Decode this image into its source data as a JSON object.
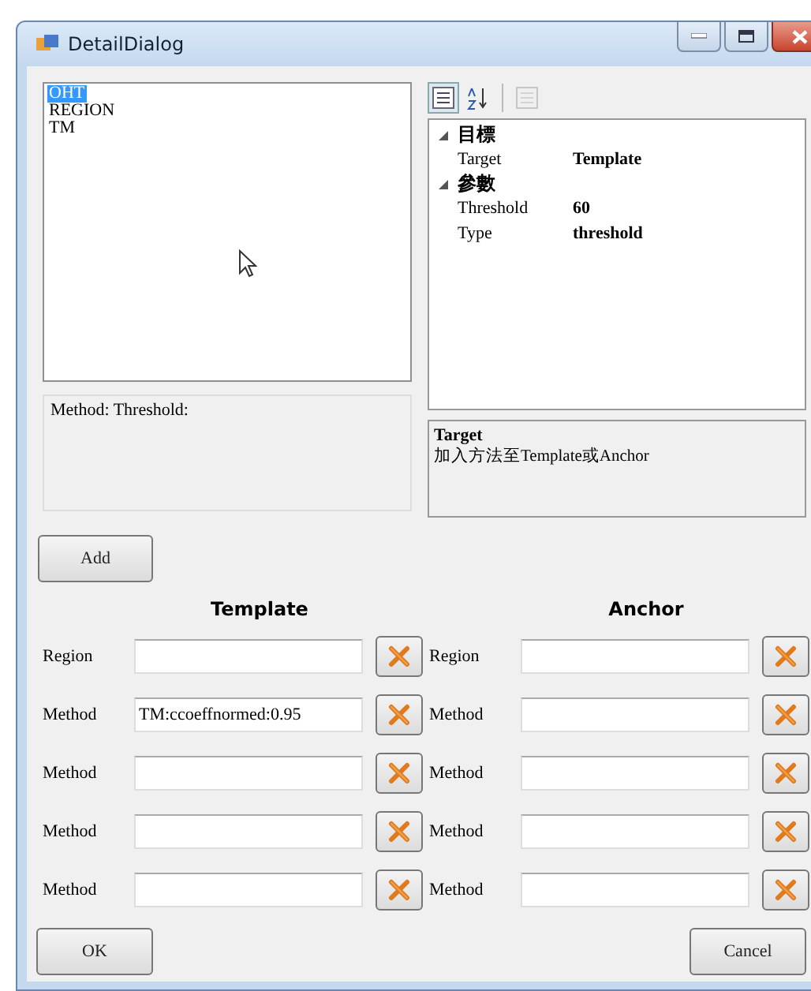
{
  "window": {
    "title": "DetailDialog"
  },
  "method_list": {
    "items": [
      {
        "label": "OHT",
        "selected": true
      },
      {
        "label": "REGION",
        "selected": false
      },
      {
        "label": "TM",
        "selected": false
      }
    ]
  },
  "method_info": "Method: Threshold:",
  "property_grid": {
    "toolbar": [
      {
        "kind": "categorized",
        "selected": true,
        "disabled": false
      },
      {
        "kind": "alphabetical",
        "selected": false,
        "disabled": false
      },
      {
        "kind": "pages",
        "selected": false,
        "disabled": true
      }
    ],
    "categories": [
      {
        "name": "目標",
        "expanded": true,
        "properties": [
          {
            "name": "Target",
            "value": "Template"
          }
        ]
      },
      {
        "name": "參數",
        "expanded": true,
        "properties": [
          {
            "name": "Threshold",
            "value": "60"
          },
          {
            "name": "Type",
            "value": "threshold"
          }
        ]
      }
    ],
    "help": {
      "title": "Target",
      "description": "加入方法至Template或Anchor"
    }
  },
  "add_button": "Add",
  "groups": [
    {
      "title": "Template",
      "rows": [
        {
          "label": "Region"
        },
        {
          "label": "Method",
          "value": "TM:ccoeffnormed:0.95"
        },
        {
          "label": "Method"
        },
        {
          "label": "Method"
        },
        {
          "label": "Method"
        }
      ]
    },
    {
      "title": "Anchor",
      "rows": [
        {
          "label": "Region"
        },
        {
          "label": "Method"
        },
        {
          "label": "Method"
        },
        {
          "label": "Method"
        },
        {
          "label": "Method"
        }
      ]
    }
  ],
  "buttons": {
    "ok": "OK",
    "cancel": "Cancel"
  }
}
